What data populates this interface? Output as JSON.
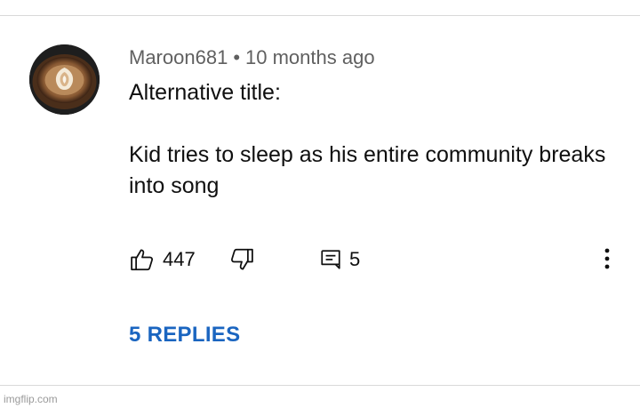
{
  "comment": {
    "author": "Maroon681",
    "separator": "•",
    "timestamp": "10 months ago",
    "text_line_1": "Alternative title:",
    "text_line_2": "Kid tries to sleep as his entire community breaks into song",
    "avatar_icon": "latte-art-avatar"
  },
  "actions": {
    "like_icon": "thumbs-up-icon",
    "like_count": "447",
    "dislike_icon": "thumbs-down-icon",
    "reply_icon": "comment-icon",
    "reply_count": "5",
    "more_icon": "more-vertical-icon"
  },
  "replies_link": "5 REPLIES",
  "watermark": "imgflip.com",
  "colors": {
    "text": "#0f0f0f",
    "meta": "#606060",
    "link": "#1a65c0"
  }
}
